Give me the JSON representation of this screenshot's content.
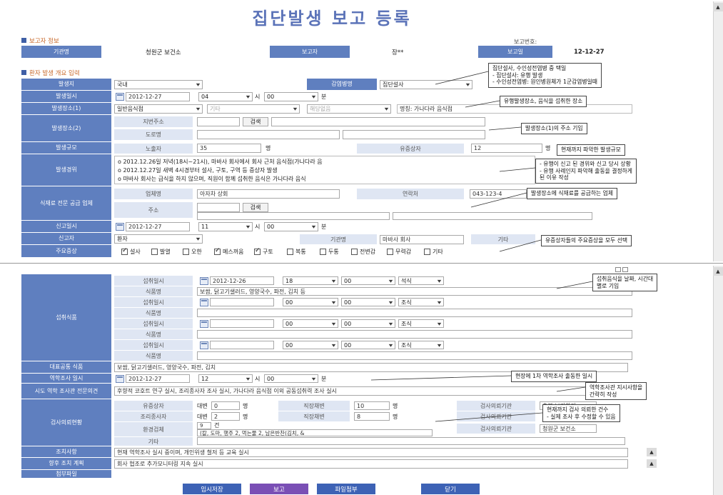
{
  "title": "집단발생 보고 등록",
  "reporter": {
    "section_title": "보고자 정보",
    "report_no_label": "보고번호:",
    "agency_label": "기관명",
    "agency_value": "청원군 보건소",
    "reporter_label": "보고자",
    "reporter_value": "장**",
    "date_label": "보고일",
    "date_value": "12-12-27"
  },
  "overview": {
    "section_title": "환자 발생 개요 입력",
    "region_label": "발생지",
    "region_value": "국내",
    "infection_route_label": "감염병명",
    "infection_route_value": "집단설사",
    "occur_dt_label": "발생일시",
    "occur_date": "2012-12-27",
    "occur_hour": "04",
    "hour_unit": "시",
    "occur_min": "00",
    "min_unit": "분",
    "place1_label": "발생장소(1)",
    "place1_type": "일반음식점",
    "place1_sub": "기타",
    "place1_sub2": "해당없음",
    "place1_name": "명칭: 가나다라 음식점",
    "place2_label": "발생장소(2)",
    "addr_jibun_label": "지번주소",
    "addr_search": "검색",
    "addr_road_label": "도로명",
    "scale_label": "발생규모",
    "exposed_label": "노출자",
    "exposed_value": "35",
    "person_unit": "명",
    "symptomatic_label": "유증상자",
    "symptomatic_value": "12",
    "history_label": "발생경위",
    "history_lines": [
      "o 2012.12.26일 저녁(18시~21시), 마바사 회사에서 회사 근처 음식점(가나다라 음",
      "o 2012.12.27일 새벽 4시경부터 설사, 구토, 구역 등 증상자 발생",
      "o 마바사 회사는 급식을 하지 않으며, 직원이 함께 섭취한 음식은 가나다라 음식"
    ],
    "supplier_label": "식재료 전문 공급 업체",
    "company_label": "업체명",
    "company_value": "아자차 상회",
    "contact_label": "연락처",
    "contact_value": "043-123-4",
    "supplier_addr_label": "주소",
    "report_dt_label": "신고일시",
    "report_date": "2012-12-27",
    "report_hour": "11",
    "report_min": "00",
    "notifier_label": "신고자",
    "notifier_value": "환자",
    "org_label": "기관명",
    "org_value": "마바사 회사",
    "other_label": "기타",
    "symptoms_label": "주요증상",
    "symptoms": [
      {
        "label": "설사",
        "checked": true
      },
      {
        "label": "발열",
        "checked": false
      },
      {
        "label": "오한",
        "checked": false
      },
      {
        "label": "메스꺼움",
        "checked": true
      },
      {
        "label": "구토",
        "checked": true
      },
      {
        "label": "복통",
        "checked": false
      },
      {
        "label": "두통",
        "checked": false
      },
      {
        "label": "전변감",
        "checked": false
      },
      {
        "label": "무력감",
        "checked": false
      },
      {
        "label": "기타",
        "checked": false
      }
    ]
  },
  "callouts": {
    "c1": [
      "집단설사, 수인성전염병 중 택일",
      "- 집단설사: 유행 발생",
      "- 수인성전염병: 원인병원체가 1군감염병일때"
    ],
    "c2": "유행발생장소, 음식을 섭취한 장소",
    "c3": "발생장소(1)의 주소 기입",
    "c4": "현재까지 파악한 발생규모",
    "c5": [
      "- 유행이 신고 된 경위와 신고 당시 상황",
      "- 유행 사례인지 파악해 출동을 결정하게",
      "된 이유 작성"
    ],
    "c6": "발생장소에 식재료를 공급하는 업체",
    "c7": "유증상자들의 주요증상을 모두 선택",
    "c8": [
      "섭취음식을 날짜, 시간대",
      "별로 기입"
    ],
    "c9": "현장에 1차 역학조사 출동한 일시",
    "c10": [
      "역학조사관 지시사항을",
      "간략히 작성"
    ],
    "c11": [
      "현재까지 검사 의뢰한 건수",
      "- 실제 조사 후 수정할 수 있음"
    ]
  },
  "intake": {
    "section_label": "섭취식품",
    "meal_dt_label": "섭취일시",
    "food_label": "식품명",
    "meals": [
      {
        "date": "2012-12-26",
        "hour": "18",
        "min": "00",
        "type": "석식",
        "food": "보쌈, 닭고기샐러드, 영양국수, 파전, 김치 등"
      },
      {
        "date": "",
        "hour": "00",
        "min": "00",
        "type": "조식",
        "food": ""
      },
      {
        "date": "",
        "hour": "00",
        "min": "00",
        "type": "조식",
        "food": ""
      },
      {
        "date": "",
        "hour": "00",
        "min": "00",
        "type": "조식",
        "food": ""
      }
    ],
    "common_food_label": "대표공통 식품",
    "common_food_value": "보쌈, 닭고기샐러드, 영양국수, 파전, 김치",
    "epi_dt_label": "역학조사 일시",
    "epi_date": "2012-12-27",
    "epi_hour": "12",
    "epi_min": "00",
    "opinion_label": "시도 역학 조사관 전문의견",
    "opinion_value": "후향적 코호트 연구 실시, 조리종사자 조사 실시, 가나다라 음식점 이외 공동섭취력 조사 실시",
    "lab_label": "검사의뢰현황",
    "sym_label": "유증상자",
    "cook_label": "조리종사자",
    "env_label": "환경검체",
    "etc_label": "기타",
    "rectal_label": "대변",
    "rectal_label2": "대변",
    "sym_rectal": "0",
    "cook_rectal": "2",
    "direct_label": "직장채변",
    "sym_direct": "10",
    "cook_direct": "8",
    "env_count": "9",
    "env_unit": "건",
    "env_detail": "(칼, 도마, 행주 2, 먹는물 2, 남은반찬(김치, &",
    "lab_org_label": "검사의뢰기관",
    "lab_org1": "충북 보건환경",
    "lab_org3": "청원군 보건소",
    "action_label": "조치사항",
    "action_value": "현재 역학조사 실시 중이며, 개인위생 철저 등 교육 실시",
    "plan_label": "향후 조치 계획",
    "plan_value": "회사 협조로 추가모니터링 지속 실시",
    "attach_label": "첨부파일"
  },
  "buttons": {
    "temp_save": "임시저장",
    "report": "보고",
    "attach": "파일첨부",
    "close": "닫기"
  }
}
